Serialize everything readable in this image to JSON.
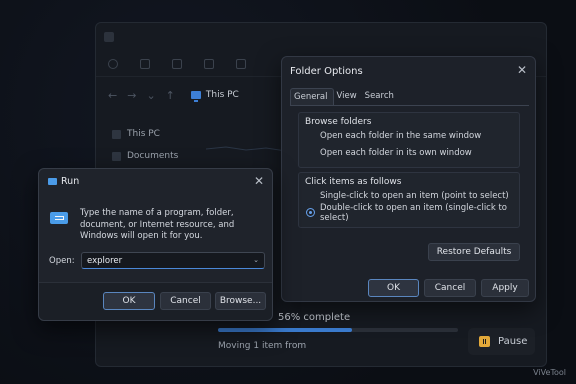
{
  "explorer": {
    "address": "This PC",
    "sidebar": [
      "This PC",
      "Documents"
    ]
  },
  "progress": {
    "label": "56% complete",
    "value": 0.56,
    "detail": "Moving 1 item from",
    "pause_label": "Pause"
  },
  "folder_options": {
    "title": "Folder Options",
    "tabs": [
      "General",
      "View",
      "Search"
    ],
    "browse_group": {
      "title": "Browse folders",
      "options": [
        "Open each folder in the same window",
        "Open each folder in its own window"
      ]
    },
    "click_group": {
      "title": "Click items as follows",
      "options": [
        "Single-click to open an item (point to select)",
        "Double-click to open an item (single-click to select)"
      ],
      "selected": 1
    },
    "restore_label": "Restore Defaults",
    "ok_label": "OK",
    "cancel_label": "Cancel",
    "apply_label": "Apply"
  },
  "run": {
    "title": "Run",
    "description": "Type the name of a program, folder, document, or Internet resource, and Windows will open it for you.",
    "open_label": "Open:",
    "input_value": "explorer",
    "ok_label": "OK",
    "cancel_label": "Cancel",
    "browse_label": "Browse..."
  },
  "watermark": "ViVeTool",
  "colors": {
    "accent": "#4a9ce9",
    "progress": "#3b7cd0",
    "pause": "#e3a93a"
  }
}
